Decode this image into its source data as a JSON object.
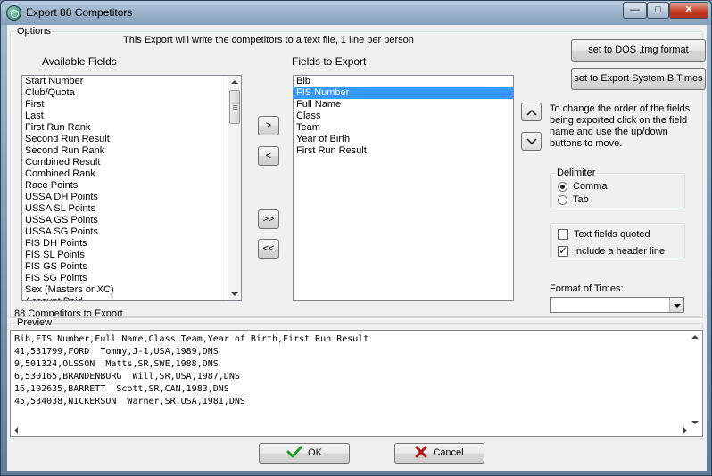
{
  "window": {
    "title": "Export 88 Competitors",
    "minimize_glyph": "—",
    "maximize_glyph": "□",
    "close_glyph": "✕"
  },
  "options": {
    "group_label": "Options",
    "description": "This Export will write the competitors to a text file, 1 line per person",
    "available_heading": "Available Fields",
    "export_heading": "Fields to Export",
    "available_fields": [
      "Start Number",
      "Club/Quota",
      "First",
      "Last",
      "First Run Rank",
      "Second Run Result",
      "Second Run Rank",
      "Combined Result",
      "Combined Rank",
      "Race Points",
      "USSA DH Points",
      "USSA SL Points",
      "USSA GS Points",
      "USSA SG Points",
      "FIS DH Points",
      "FIS SL Points",
      "FIS GS Points",
      "FIS SG Points",
      "Sex (Masters or XC)",
      "Account Paid"
    ],
    "export_fields": [
      "Bib",
      "FIS Number",
      "Full Name",
      "Class",
      "Team",
      "Year of Birth",
      "First Run Result"
    ],
    "selected_export_field": "FIS Number",
    "move_right_label": ">",
    "move_left_label": "<",
    "move_all_right_label": ">>",
    "move_all_left_label": "<<",
    "dos_button": "set to DOS .tmg format",
    "system_b_button": "set to Export System B Times",
    "order_help": "To change the order of the fields being exported click on the field name and use the up/down buttons to move.",
    "delimiter": {
      "label": "Delimiter",
      "options": [
        "Comma",
        "Tab"
      ],
      "selected": "Comma"
    },
    "text_fields_quoted": {
      "label": "Text fields quoted",
      "checked": false
    },
    "include_header": {
      "label": "Include a header line",
      "checked": true
    },
    "format_of_times_label": "Format of Times:",
    "format_of_times_value": "",
    "competitors_status": "88 Competitors to Export"
  },
  "preview": {
    "label": "Preview",
    "lines": [
      "Bib,FIS Number,Full Name,Class,Team,Year of Birth,First Run Result",
      "41,531799,FORD  Tommy,J-1,USA,1989,DNS",
      "9,501324,OLSSON  Matts,SR,SWE,1988,DNS",
      "6,530165,BRANDENBURG  Will,SR,USA,1987,DNS",
      "16,102635,BARRETT  Scott,SR,CAN,1983,DNS",
      "45,534038,NICKERSON  Warner,SR,USA,1981,DNS"
    ]
  },
  "footer": {
    "ok_label": "OK",
    "cancel_label": "Cancel",
    "ok_icon_color": "#1e9e1e",
    "cancel_icon_color": "#b01a1a"
  }
}
